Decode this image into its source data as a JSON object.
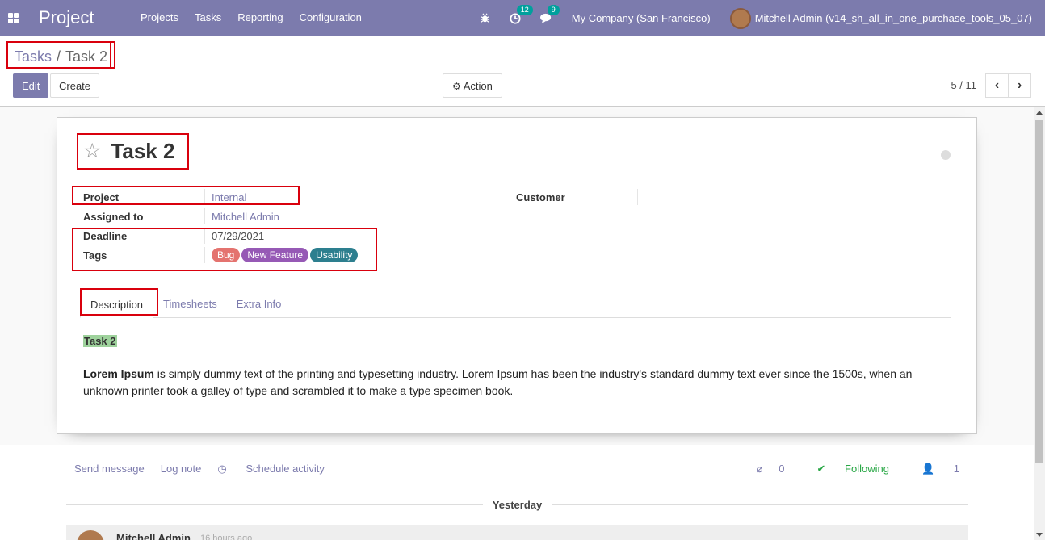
{
  "app": {
    "brand": "Project",
    "menu": [
      "Projects",
      "Tasks",
      "Reporting",
      "Configuration"
    ],
    "activity_count": "12",
    "message_count": "9",
    "company": "My Company (San Francisco)",
    "user": "Mitchell Admin (v14_sh_all_in_one_purchase_tools_05_07)"
  },
  "control": {
    "breadcrumb_parent": "Tasks",
    "breadcrumb_sep": "/",
    "breadcrumb_current": "Task 2",
    "edit_label": "Edit",
    "create_label": "Create",
    "action_label": "Action",
    "pager": "5 / 11"
  },
  "task": {
    "title": "Task 2",
    "fields": {
      "project_label": "Project",
      "project_value": "Internal",
      "customer_label": "Customer",
      "assigned_label": "Assigned to",
      "assigned_value": "Mitchell Admin",
      "deadline_label": "Deadline",
      "deadline_value": "07/29/2021",
      "tags_label": "Tags"
    },
    "tags": [
      {
        "label": "Bug",
        "color": "#e4736f"
      },
      {
        "label": "New Feature",
        "color": "#9659b5"
      },
      {
        "label": "Usability",
        "color": "#2d7f8f"
      }
    ],
    "tabs": [
      "Description",
      "Timesheets",
      "Extra Info"
    ],
    "description": {
      "heading": "Task 2",
      "lead": "Lorem Ipsum",
      "body": " is simply dummy text of the printing and typesetting industry. Lorem Ipsum has been the industry's standard dummy text ever since the 1500s, when an unknown printer took a galley of type and scrambled it to make a type specimen book."
    }
  },
  "chatter": {
    "send_message": "Send message",
    "log_note": "Log note",
    "schedule_activity": "Schedule activity",
    "attachments": "0",
    "following": "Following",
    "followers": "1",
    "date_separator": "Yesterday",
    "message_author": "Mitchell Admin",
    "message_time": "16 hours ago"
  }
}
